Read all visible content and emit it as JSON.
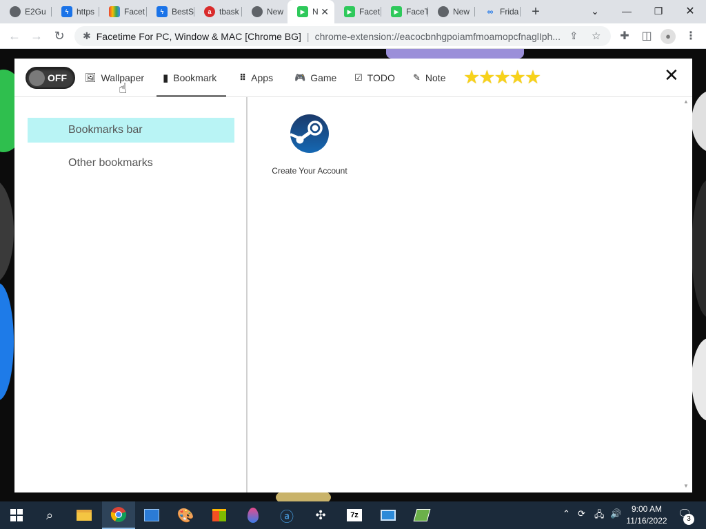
{
  "browser": {
    "tabs": [
      {
        "title": "E2Gu",
        "icon": "chrome-icon"
      },
      {
        "title": "https",
        "icon": "lightning-icon"
      },
      {
        "title": "Facet",
        "icon": "color-wheel-icon"
      },
      {
        "title": "BestS",
        "icon": "lightning-icon"
      },
      {
        "title": "tbask",
        "icon": "ask-icon"
      },
      {
        "title": "New",
        "icon": "chrome-icon"
      },
      {
        "title": "N",
        "icon": "facetime-icon",
        "active": true
      },
      {
        "title": "Facet",
        "icon": "facetime-icon"
      },
      {
        "title": "FaceT",
        "icon": "facetime-icon"
      },
      {
        "title": "New",
        "icon": "chrome-icon"
      },
      {
        "title": "Frida",
        "icon": "link-icon"
      }
    ],
    "address_bar": {
      "page_title": "Facetime For PC, Window & MAC [Chrome BG]",
      "url": "chrome-extension://eacocbnhgpoiamfmoamopcfnaglIph..."
    }
  },
  "extension": {
    "toggle_label": "OFF",
    "nav": [
      {
        "label": "Wallpaper",
        "icon": "image-icon"
      },
      {
        "label": "Bookmark",
        "icon": "bookmark-icon",
        "active": true
      },
      {
        "label": "Apps",
        "icon": "grid-icon"
      },
      {
        "label": "Game",
        "icon": "gamepad-icon"
      },
      {
        "label": "TODO",
        "icon": "checklist-icon"
      },
      {
        "label": "Note",
        "icon": "note-icon"
      }
    ],
    "rating_stars": 5,
    "sidebar": {
      "items": [
        {
          "label": "Bookmarks bar",
          "active": true
        },
        {
          "label": "Other bookmarks"
        }
      ]
    },
    "bookmarks": [
      {
        "label": "Create Your Account",
        "icon": "steam-icon"
      }
    ]
  },
  "taskbar": {
    "time": "9:00 AM",
    "date": "11/16/2022",
    "notification_count": "3",
    "apps": [
      "start",
      "search",
      "file-explorer",
      "chrome",
      "photos",
      "paint",
      "store",
      "edge-dev",
      "alexa",
      "network-app",
      "7zip",
      "remote-desktop",
      "sheets-app"
    ]
  },
  "colors": {
    "active_sidebar": "#b9f4f5",
    "stars": "#f7d21a",
    "taskbar": "#1b2a3a"
  }
}
